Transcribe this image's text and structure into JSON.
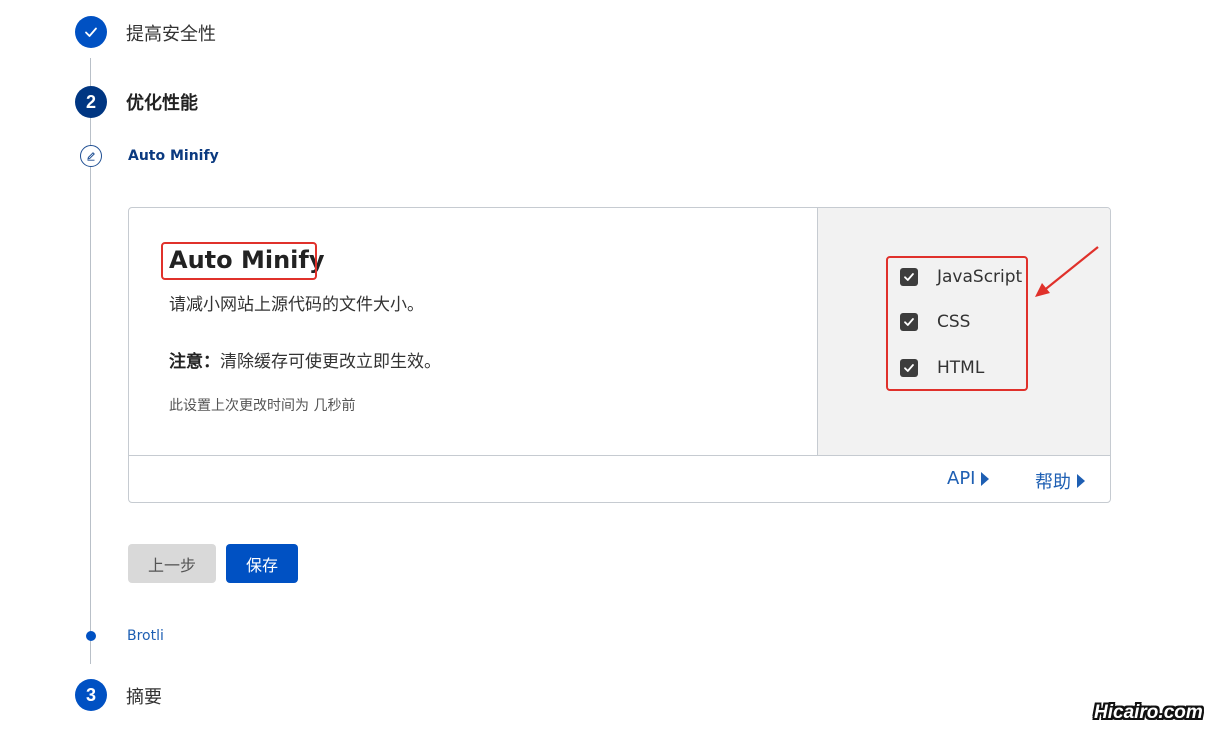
{
  "steps": [
    {
      "label": "提高安全性",
      "status": "done"
    },
    {
      "number": "2",
      "label": "优化性能",
      "status": "active"
    },
    {
      "number": "3",
      "label": "摘要",
      "status": "pending"
    }
  ],
  "substeps": [
    {
      "label": "Auto Minify",
      "status": "active"
    },
    {
      "label": "Brotli",
      "status": "pending"
    }
  ],
  "card": {
    "title": "Auto Minify",
    "description": "请减小网站上源代码的文件大小。",
    "note_label": "注意：",
    "note_text": "清除缓存可使更改立即生效。",
    "last_modified": "此设置上次更改时间为 几秒前",
    "checkboxes": [
      {
        "label": "JavaScript",
        "checked": true
      },
      {
        "label": "CSS",
        "checked": true
      },
      {
        "label": "HTML",
        "checked": true
      }
    ],
    "footer_links": [
      {
        "label": "API"
      },
      {
        "label": "帮助"
      }
    ]
  },
  "buttons": {
    "previous_label": "上一步",
    "save_label": "保存"
  },
  "watermark": "Hicairo.com",
  "colors": {
    "primary": "#0051c3",
    "step_active": "#003682",
    "link": "#1e5fb3",
    "annotation": "#e0312b"
  }
}
